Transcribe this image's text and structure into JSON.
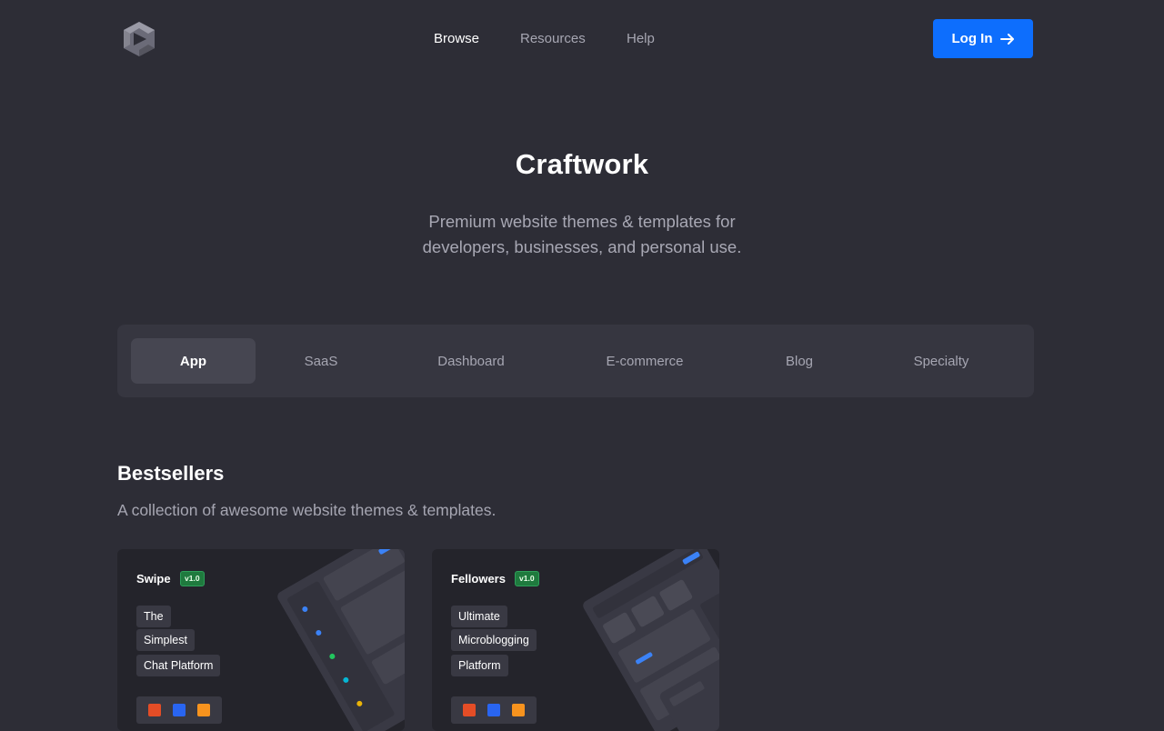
{
  "header": {
    "nav": [
      {
        "label": "Browse",
        "active": true
      },
      {
        "label": "Resources",
        "active": false
      },
      {
        "label": "Help",
        "active": false
      }
    ],
    "login_label": "Log In",
    "login_icon": "arrow-right-icon",
    "accent": "#0d6efd"
  },
  "hero": {
    "title": "Craftwork",
    "subtitle_line1": "Premium website themes & templates for",
    "subtitle_line2": "developers, businesses, and personal use."
  },
  "tabs": [
    {
      "label": "App",
      "active": true
    },
    {
      "label": "SaaS",
      "active": false
    },
    {
      "label": "Dashboard",
      "active": false
    },
    {
      "label": "E-commerce",
      "active": false
    },
    {
      "label": "Blog",
      "active": false
    },
    {
      "label": "Specialty",
      "active": false
    }
  ],
  "section": {
    "title": "Bestsellers",
    "subtitle": "A collection of awesome website themes & templates."
  },
  "cards": [
    {
      "name": "Swipe",
      "version": "v1.0",
      "tags": [
        "The",
        "Simplest",
        "Chat Platform"
      ],
      "tech_icons": [
        "html5-icon",
        "css3-icon",
        "sketch-icon"
      ]
    },
    {
      "name": "Fellowers",
      "version": "v1.0",
      "tags": [
        "Ultimate",
        "Microblogging",
        "Platform"
      ],
      "tech_icons": [
        "html5-icon",
        "css3-icon",
        "sketch-icon"
      ]
    }
  ],
  "colors": {
    "background": "#2d2d36",
    "panel": "#363640",
    "active_tab": "#464651",
    "muted_text": "#a6a6b2",
    "version_badge": "#1f7a3e"
  }
}
